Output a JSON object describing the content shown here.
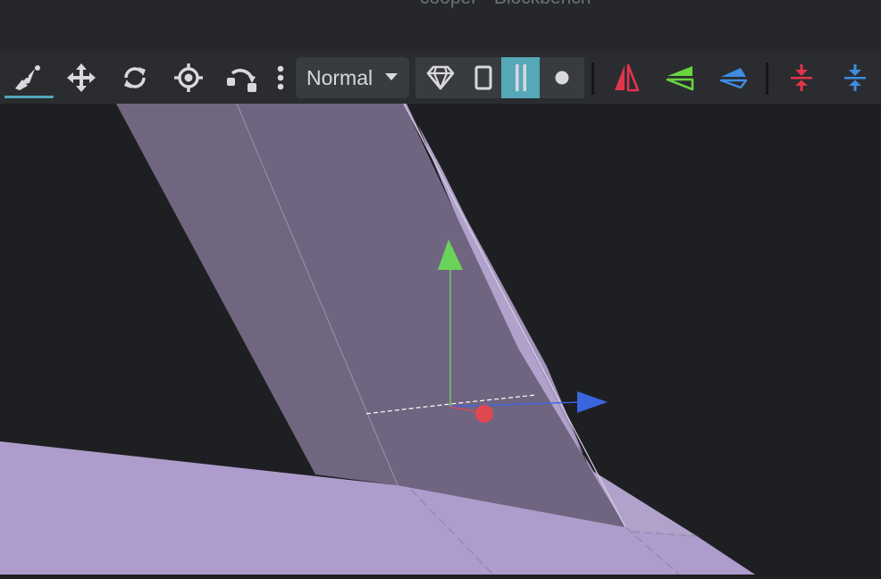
{
  "window": {
    "title": "cooper - Blockbench"
  },
  "toolbar": {
    "tools": [
      {
        "name": "vertex-snap-tool",
        "icon": "vertex-snap-icon",
        "active": true
      },
      {
        "name": "move-tool",
        "icon": "move-icon",
        "active": false
      },
      {
        "name": "rotate-tool",
        "icon": "rotate-icon",
        "active": false
      },
      {
        "name": "pivot-tool",
        "icon": "pivot-icon",
        "active": false
      },
      {
        "name": "bend-tool",
        "icon": "bend-icon",
        "active": false
      }
    ],
    "more_icon": "more-vertical-icon",
    "mode_select": {
      "selected": "Normal",
      "icon": "caret-down-icon"
    },
    "selection_modes": [
      {
        "name": "object",
        "icon": "diamond-icon",
        "active": false
      },
      {
        "name": "face",
        "icon": "face-icon",
        "active": false
      },
      {
        "name": "edge",
        "icon": "edge-icon",
        "active": true
      },
      {
        "name": "vertex",
        "icon": "vertex-icon",
        "active": false
      }
    ],
    "axis_tools": [
      {
        "name": "mirror-x",
        "icon": "mirror-x-icon",
        "color": "#e0354b"
      },
      {
        "name": "mirror-y",
        "icon": "mirror-y-icon",
        "color": "#69d43e"
      },
      {
        "name": "mirror-z",
        "icon": "mirror-z-icon",
        "color": "#3f8be0"
      }
    ],
    "merge_tools": [
      {
        "name": "merge-red",
        "icon": "merge-icon",
        "color": "#e0354b"
      },
      {
        "name": "merge-blue",
        "icon": "merge-icon",
        "color": "#3f8be0"
      }
    ]
  },
  "colors": {
    "background": "#1e1f22",
    "toolbar": "#2a2c30",
    "accent": "#57a8b8",
    "mesh_light": "#ae9ccc",
    "mesh_dark": "#71667f",
    "gizmo_x": "#e0484f",
    "gizmo_y": "#6ad45a",
    "gizmo_z": "#3a66e0"
  }
}
